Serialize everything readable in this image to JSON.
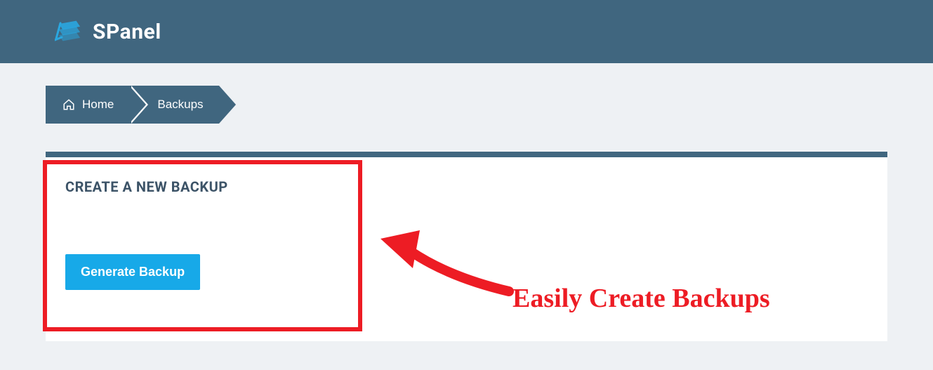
{
  "header": {
    "brand": "SPanel"
  },
  "breadcrumb": {
    "home": "Home",
    "current": "Backups"
  },
  "panel": {
    "title": "CREATE A NEW BACKUP",
    "button": "Generate Backup"
  },
  "annotation": {
    "text": "Easily Create Backups"
  }
}
